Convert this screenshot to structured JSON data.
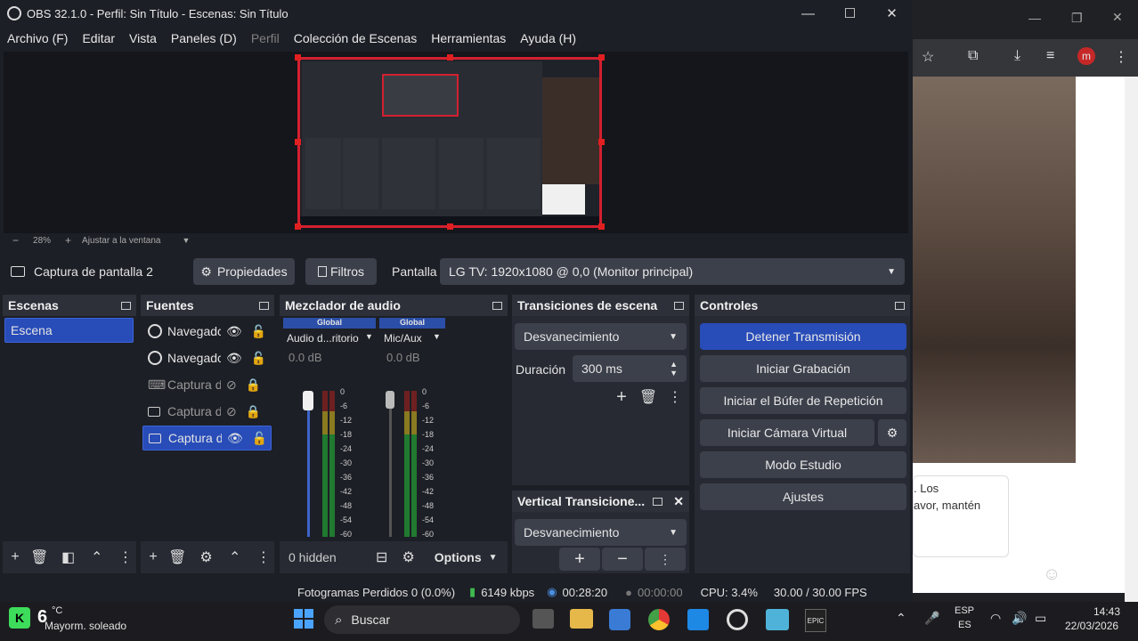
{
  "window": {
    "title": "OBS 32.1.0 - Perfil: Sin Título - Escenas: Sin Título",
    "minimize": "—",
    "maximize": "☐",
    "close": "✕"
  },
  "menu": {
    "items": [
      "Archivo (F)",
      "Editar",
      "Vista",
      "Paneles (D)",
      "Perfil",
      "Colección de Escenas",
      "Herramientas",
      "Ayuda (H)"
    ]
  },
  "preview": {
    "zoom_out": "−",
    "zoom_level": "28%",
    "zoom_in": "+",
    "fit_label": "Ajustar a la ventana"
  },
  "source_toolbar": {
    "source_name": "Captura de pantalla 2",
    "properties": "Propiedades",
    "filters": "Filtros",
    "screen_label": "Pantalla",
    "screen_value": "LG TV: 1920x1080 @ 0,0 (Monitor principal)"
  },
  "scenes": {
    "title": "Escenas",
    "items": [
      "Escena"
    ]
  },
  "sources": {
    "title": "Fuentes",
    "items": [
      {
        "label": "Navegadc",
        "icon": "globe-icon",
        "visible": true,
        "locked": false
      },
      {
        "label": "Navegadc",
        "icon": "globe-icon",
        "visible": true,
        "locked": false
      },
      {
        "label": "Captura d",
        "icon": "gamepad-icon",
        "visible": false,
        "locked": true
      },
      {
        "label": "Captura d",
        "icon": "monitor-icon",
        "visible": false,
        "locked": true
      },
      {
        "label": "Captura d",
        "icon": "monitor-icon",
        "visible": true,
        "locked": false
      }
    ]
  },
  "mixer": {
    "title": "Mezclador de audio",
    "channels": [
      {
        "badge": "Global",
        "name": "Audio d...ritorio",
        "db": "0.0 dB"
      },
      {
        "badge": "Global",
        "name": "Mic/Aux",
        "db": "0.0 dB"
      }
    ],
    "ticks": [
      "0",
      "-6",
      "-12",
      "-18",
      "-24",
      "-30",
      "-36",
      "-42",
      "-48",
      "-54",
      "-60"
    ],
    "hidden": "0 hidden",
    "options": "Options"
  },
  "transitions": {
    "title": "Transiciones de escena",
    "transition": "Desvanecimiento",
    "duration_label": "Duración",
    "duration_value": "300 ms"
  },
  "vertical_transitions": {
    "title": "Vertical Transicione...",
    "transition": "Desvanecimiento"
  },
  "controls": {
    "title": "Controles",
    "stop_stream": "Detener Transmisión",
    "start_recording": "Iniciar Grabación",
    "replay_buffer": "Iniciar el Búfer de Repetición",
    "virtual_cam": "Iniciar Cámara Virtual",
    "studio_mode": "Modo Estudio",
    "settings": "Ajustes"
  },
  "status": {
    "dropped_frames": "Fotogramas Perdidos 0 (0.0%)",
    "bitrate": "6149 kbps",
    "stream_time": "00:28:20",
    "record_time": "00:00:00",
    "cpu": "CPU: 3.4%",
    "fps": "30.00 / 30.00 FPS"
  },
  "browser": {
    "avatar": "m",
    "chat_text_1": ". Los",
    "chat_text_2": "avor, mantén"
  },
  "taskbar": {
    "weather_temp": "6",
    "weather_unit": "°C",
    "weather_desc": "Mayorm. soleado",
    "search": "Buscar",
    "lang1": "ESP",
    "lang2": "ES",
    "time": "14:43",
    "date": "22/03/2026"
  },
  "colors": {
    "accent": "#284cb8",
    "record_red": "#d32030",
    "panel": "#272a33",
    "background": "#1d1f26"
  }
}
